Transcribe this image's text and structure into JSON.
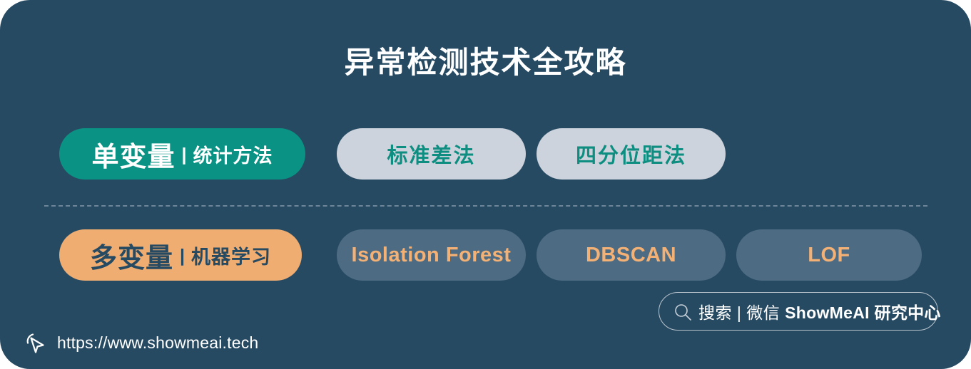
{
  "card": {
    "background_color": "#274a63",
    "title": "异常检测技术全攻略"
  },
  "rows": [
    {
      "id": "univariate",
      "category": {
        "main": "单变量",
        "separator": "|",
        "sub": "统计方法",
        "background_color": "#0a9384",
        "text_color": "#ffffff"
      },
      "methods": [
        {
          "label": "标准差法",
          "background_color": "#ccd3dc",
          "text_color": "#0d8e80"
        },
        {
          "label": "四分位距法",
          "background_color": "#ccd3dc",
          "text_color": "#0d8e80"
        }
      ]
    },
    {
      "id": "multivariate",
      "category": {
        "main": "多变量",
        "separator": "|",
        "sub": "机器学习",
        "background_color": "#efad72",
        "text_color": "#274a63"
      },
      "methods": [
        {
          "label": "Isolation Forest",
          "background_color": "#4d6b82",
          "text_color": "#f3b175"
        },
        {
          "label": "DBSCAN",
          "background_color": "#4d6b82",
          "text_color": "#f3b175"
        },
        {
          "label": "LOF",
          "background_color": "#4d6b82",
          "text_color": "#f3b175"
        }
      ]
    }
  ],
  "search_chip": {
    "icon": "search-icon",
    "prefix": "搜索 | 微信 ",
    "brand": "ShowMeAI",
    "suffix": " 研究中心"
  },
  "footer": {
    "icon": "cursor-click-icon",
    "url": "https://www.showmeai.tech"
  }
}
